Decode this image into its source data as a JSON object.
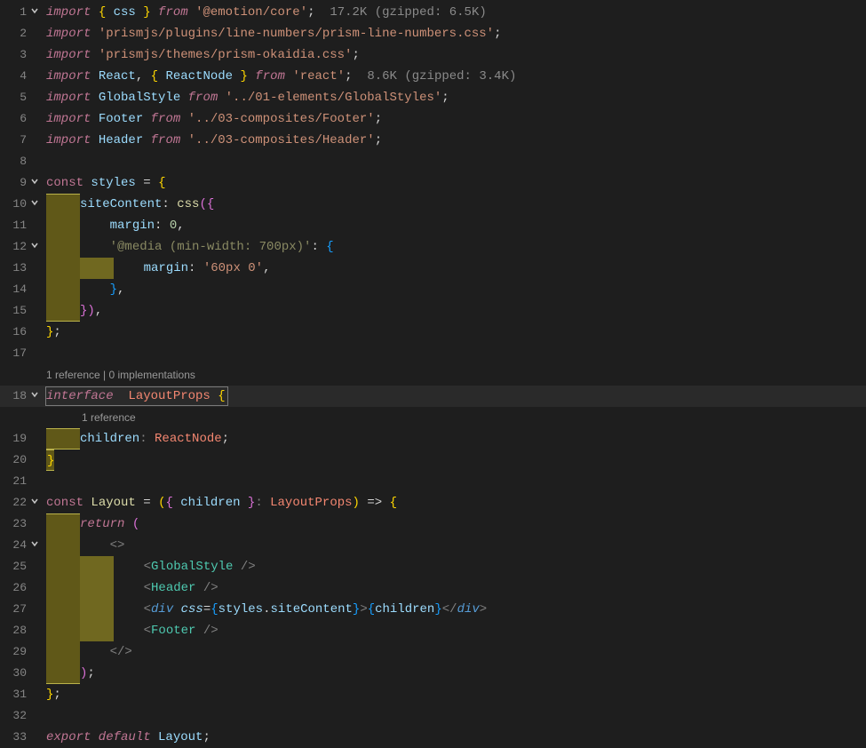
{
  "lines": [
    {
      "n": 1,
      "fold": true,
      "tokens": [
        [
          "kw",
          "import "
        ],
        [
          "brace-y",
          "{ "
        ],
        [
          "var",
          "css"
        ],
        [
          "brace-y",
          " }"
        ],
        [
          "kw",
          " from "
        ],
        [
          "str",
          "'@emotion/core'"
        ],
        [
          "punc",
          ";  "
        ],
        [
          "size",
          "17.2K (gzipped: 6.5K)"
        ]
      ]
    },
    {
      "n": 2,
      "tokens": [
        [
          "kw",
          "import "
        ],
        [
          "str",
          "'prismjs/plugins/line-numbers/prism-line-numbers.css'"
        ],
        [
          "punc",
          ";"
        ]
      ]
    },
    {
      "n": 3,
      "tokens": [
        [
          "kw",
          "import "
        ],
        [
          "str",
          "'prismjs/themes/prism-okaidia.css'"
        ],
        [
          "punc",
          ";"
        ]
      ]
    },
    {
      "n": 4,
      "tokens": [
        [
          "kw",
          "import "
        ],
        [
          "var",
          "React"
        ],
        [
          "punc",
          ", "
        ],
        [
          "brace-y",
          "{ "
        ],
        [
          "var",
          "ReactNode"
        ],
        [
          "brace-y",
          " }"
        ],
        [
          "kw",
          " from "
        ],
        [
          "str",
          "'react'"
        ],
        [
          "punc",
          ";  "
        ],
        [
          "size",
          "8.6K (gzipped: 3.4K)"
        ]
      ]
    },
    {
      "n": 5,
      "tokens": [
        [
          "kw",
          "import "
        ],
        [
          "var",
          "GlobalStyle"
        ],
        [
          "kw",
          " from "
        ],
        [
          "str",
          "'../01-elements/GlobalStyles'"
        ],
        [
          "punc",
          ";"
        ]
      ]
    },
    {
      "n": 6,
      "tokens": [
        [
          "kw",
          "import "
        ],
        [
          "var",
          "Footer"
        ],
        [
          "kw",
          " from "
        ],
        [
          "str",
          "'../03-composites/Footer'"
        ],
        [
          "punc",
          ";"
        ]
      ]
    },
    {
      "n": 7,
      "tokens": [
        [
          "kw",
          "import "
        ],
        [
          "var",
          "Header"
        ],
        [
          "kw",
          " from "
        ],
        [
          "str",
          "'../03-composites/Header'"
        ],
        [
          "punc",
          ";"
        ]
      ]
    },
    {
      "n": 8,
      "tokens": []
    },
    {
      "n": 9,
      "fold": true,
      "tokens": [
        [
          "kw2",
          "const "
        ],
        [
          "var",
          "styles"
        ],
        [
          "op",
          " = "
        ],
        [
          "brace-y",
          "{"
        ]
      ]
    },
    {
      "n": 10,
      "fold": true,
      "diff": "c38",
      "tokens": [
        [
          "raw",
          "    "
        ],
        [
          "prop",
          "siteContent"
        ],
        [
          "punc",
          ": "
        ],
        [
          "fn",
          "css"
        ],
        [
          "brace-p",
          "({"
        ]
      ]
    },
    {
      "n": 11,
      "diff": "o38",
      "tokens": [
        [
          "raw",
          "        "
        ],
        [
          "prop",
          "margin"
        ],
        [
          "punc",
          ": "
        ],
        [
          "num",
          "0"
        ],
        [
          "punc",
          ","
        ]
      ]
    },
    {
      "n": 12,
      "fold": true,
      "diff": "o38",
      "tokens": [
        [
          "raw",
          "        "
        ],
        [
          "str-g",
          "'@media (min-width: 700px)'"
        ],
        [
          "punc",
          ": "
        ],
        [
          "brace-b",
          "{"
        ]
      ]
    },
    {
      "n": 13,
      "diff": "o76",
      "tokens": [
        [
          "raw",
          "            "
        ],
        [
          "prop",
          "margin"
        ],
        [
          "punc",
          ": "
        ],
        [
          "str",
          "'60px 0'"
        ],
        [
          "punc",
          ","
        ]
      ]
    },
    {
      "n": 14,
      "diff": "o38",
      "tokens": [
        [
          "raw",
          "        "
        ],
        [
          "brace-b",
          "}"
        ],
        [
          "punc",
          ","
        ]
      ]
    },
    {
      "n": 15,
      "diff": "b38",
      "tokens": [
        [
          "raw",
          "    "
        ],
        [
          "brace-p",
          "})"
        ],
        [
          "punc",
          ","
        ]
      ]
    },
    {
      "n": 16,
      "tokens": [
        [
          "brace-y",
          "}"
        ],
        [
          "punc",
          ";"
        ]
      ]
    },
    {
      "n": 17,
      "tokens": []
    }
  ],
  "codelens1": "1 reference | 0 implementations",
  "line18": {
    "n": 18,
    "fold": true,
    "highlight": true,
    "tokens": [
      [
        "kw",
        "interface  "
      ],
      [
        "type-red",
        "LayoutProps "
      ],
      [
        "brace-y",
        "{"
      ]
    ]
  },
  "codelens2": "1 reference",
  "lines2": [
    {
      "n": 19,
      "diff": "s38",
      "tokens": [
        [
          "raw",
          "    "
        ],
        [
          "prop",
          "children"
        ],
        [
          "punc-g",
          ": "
        ],
        [
          "type-red",
          "ReactNode"
        ],
        [
          "punc",
          ";"
        ]
      ]
    },
    {
      "n": 20,
      "diff1": true,
      "tokens": [
        [
          "brace-y",
          "}"
        ]
      ]
    },
    {
      "n": 21,
      "tokens": []
    },
    {
      "n": 22,
      "fold": true,
      "tokens": [
        [
          "kw2",
          "const "
        ],
        [
          "fn",
          "Layout"
        ],
        [
          "op",
          " = "
        ],
        [
          "brace-y",
          "("
        ],
        [
          "brace-p",
          "{ "
        ],
        [
          "var",
          "children"
        ],
        [
          "brace-p",
          " }"
        ],
        [
          "punc-g",
          ": "
        ],
        [
          "type-red",
          "LayoutProps"
        ],
        [
          "brace-y",
          ")"
        ],
        [
          "op",
          " => "
        ],
        [
          "brace-y",
          "{"
        ]
      ]
    },
    {
      "n": 23,
      "diff": "c38",
      "tokens": [
        [
          "raw",
          "    "
        ],
        [
          "kw",
          "return "
        ],
        [
          "brace-p",
          "("
        ]
      ]
    },
    {
      "n": 24,
      "fold": true,
      "diff": "o38",
      "tokens": [
        [
          "raw",
          "        "
        ],
        [
          "angle",
          "<>"
        ]
      ]
    },
    {
      "n": 25,
      "diff": "o76",
      "tokens": [
        [
          "raw",
          "            "
        ],
        [
          "angle",
          "<"
        ],
        [
          "jsx",
          "GlobalStyle "
        ],
        [
          "angle",
          "/>"
        ]
      ]
    },
    {
      "n": 26,
      "diff": "o76",
      "tokens": [
        [
          "raw",
          "            "
        ],
        [
          "angle",
          "<"
        ],
        [
          "jsx",
          "Header "
        ],
        [
          "angle",
          "/>"
        ]
      ]
    },
    {
      "n": 27,
      "diff": "o76",
      "tokens": [
        [
          "raw",
          "            "
        ],
        [
          "angle",
          "<"
        ],
        [
          "jsxhtml",
          "div "
        ],
        [
          "attr",
          "css"
        ],
        [
          "op",
          "="
        ],
        [
          "brace-b",
          "{"
        ],
        [
          "var",
          "styles"
        ],
        [
          "punc",
          "."
        ],
        [
          "prop",
          "siteContent"
        ],
        [
          "brace-b",
          "}"
        ],
        [
          "angle",
          ">"
        ],
        [
          "brace-b",
          "{"
        ],
        [
          "var",
          "children"
        ],
        [
          "brace-b",
          "}"
        ],
        [
          "angle",
          "</"
        ],
        [
          "jsxhtml",
          "div"
        ],
        [
          "angle",
          ">"
        ]
      ]
    },
    {
      "n": 28,
      "diff": "o76",
      "tokens": [
        [
          "raw",
          "            "
        ],
        [
          "angle",
          "<"
        ],
        [
          "jsx",
          "Footer "
        ],
        [
          "angle",
          "/>"
        ]
      ]
    },
    {
      "n": 29,
      "diff": "o38",
      "tokens": [
        [
          "raw",
          "        "
        ],
        [
          "angle",
          "</>"
        ]
      ]
    },
    {
      "n": 30,
      "diff": "b38",
      "tokens": [
        [
          "raw",
          "    "
        ],
        [
          "brace-p",
          ")"
        ],
        [
          "punc",
          ";"
        ]
      ]
    },
    {
      "n": 31,
      "tokens": [
        [
          "brace-y",
          "}"
        ],
        [
          "punc",
          ";"
        ]
      ]
    },
    {
      "n": 32,
      "tokens": []
    },
    {
      "n": 33,
      "tokens": [
        [
          "kw",
          "export default "
        ],
        [
          "var",
          "Layout"
        ],
        [
          "punc",
          ";"
        ]
      ]
    }
  ]
}
